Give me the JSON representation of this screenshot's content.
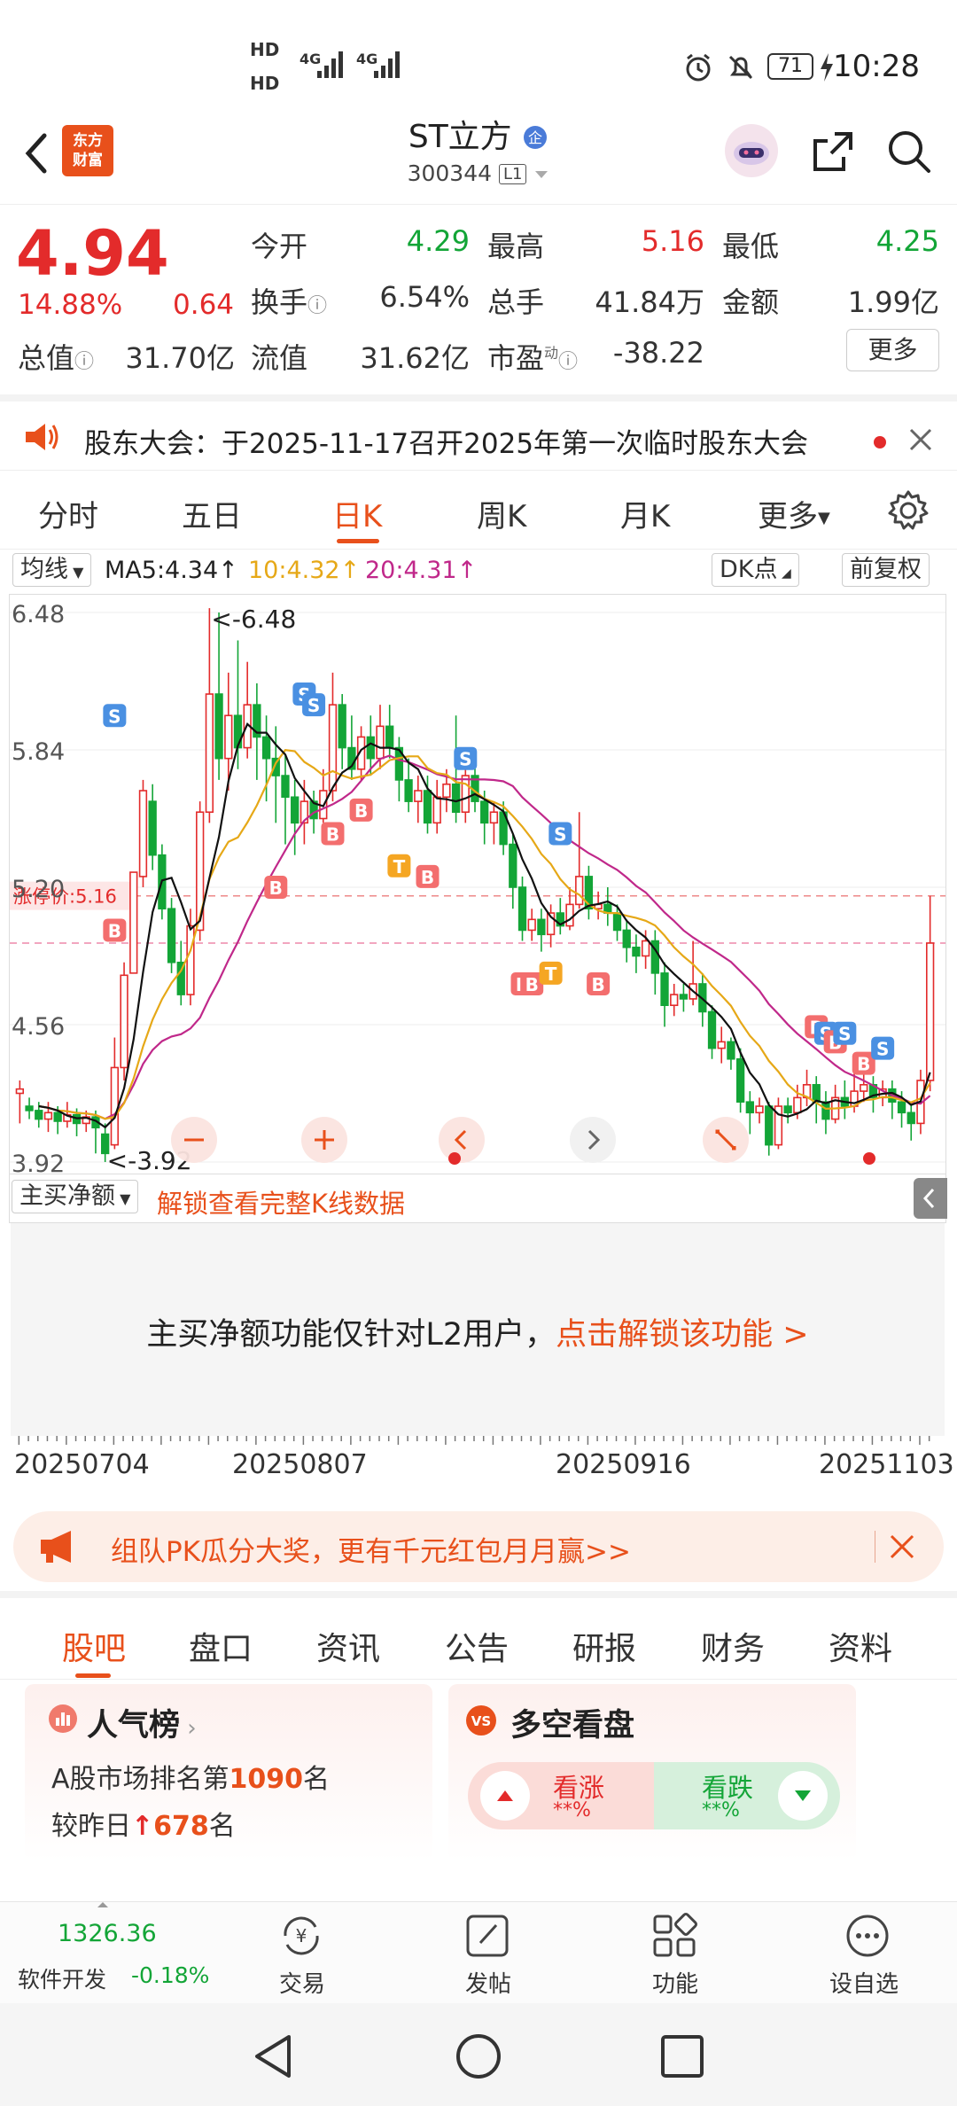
{
  "status_bar": {
    "hd1": "HD",
    "hd2": "HD",
    "net1": "4G",
    "net2": "4G",
    "battery": "71",
    "time": "10:28"
  },
  "header": {
    "logo_line1": "东方",
    "logo_line2": "财富",
    "title": "ST立方",
    "code": "300344",
    "level": "L1"
  },
  "quote": {
    "price": "4.94",
    "change_pct": "14.88%",
    "change": "0.64",
    "fields": [
      {
        "label": "今开",
        "value": "4.29"
      },
      {
        "label": "最高",
        "value": "5.16"
      },
      {
        "label": "最低",
        "value": "4.25"
      },
      {
        "label": "换手",
        "value": "6.54%"
      },
      {
        "label": "总手",
        "value": "41.84万"
      },
      {
        "label": "金额",
        "value": "1.99亿"
      },
      {
        "label": "总值",
        "value": "31.70亿"
      },
      {
        "label": "流值",
        "value": "31.62亿"
      },
      {
        "label": "市盈",
        "value": "-38.22"
      }
    ],
    "pe_sup": "动",
    "more_label": "更多"
  },
  "notice": {
    "text": "股东大会：于2025-11-17召开2025年第一次临时股东大会"
  },
  "chart_tabs": [
    "分时",
    "五日",
    "日K",
    "周K",
    "月K",
    "更多"
  ],
  "ma_bar": {
    "select": "均线",
    "ma5": "MA5:4.34↑",
    "ma10": "10:4.32↑",
    "ma20": "20:4.31↑",
    "dk": "DK点",
    "adj": "前复权"
  },
  "colors": {
    "accent": "#e8501b",
    "up": "#e32b2b",
    "down": "#13a537",
    "ma5": "#111111",
    "ma10": "#e6a817",
    "ma20": "#c0288a",
    "buy": "#f36e6e",
    "sell": "#4a90e2",
    "t": "#f5a623"
  },
  "chart_data": {
    "type": "candlestick",
    "y_ticks": [
      "6.48",
      "5.84",
      "5.20",
      "4.56",
      "3.92"
    ],
    "ylim": [
      3.92,
      6.48
    ],
    "max_label": "<-6.48",
    "min_label": "<-3.92",
    "limit_label": "涨停价:5.16",
    "limit_price": 5.16,
    "last_close": 4.94,
    "candles": [
      {
        "o": 4.24,
        "c": 4.26,
        "h": 4.3,
        "l": 4.1
      },
      {
        "o": 4.18,
        "c": 4.16,
        "h": 4.22,
        "l": 4.12
      },
      {
        "o": 4.16,
        "c": 4.12,
        "h": 4.2,
        "l": 4.08
      },
      {
        "o": 4.12,
        "c": 4.15,
        "h": 4.2,
        "l": 4.06
      },
      {
        "o": 4.15,
        "c": 4.11,
        "h": 4.18,
        "l": 4.05
      },
      {
        "o": 4.11,
        "c": 4.14,
        "h": 4.2,
        "l": 4.08
      },
      {
        "o": 4.14,
        "c": 4.1,
        "h": 4.17,
        "l": 4.04
      },
      {
        "o": 4.1,
        "c": 4.13,
        "h": 4.16,
        "l": 4.06
      },
      {
        "o": 4.13,
        "c": 4.08,
        "h": 4.16,
        "l": 3.96
      },
      {
        "o": 4.05,
        "c": 3.96,
        "h": 4.1,
        "l": 3.92
      },
      {
        "o": 4.0,
        "c": 4.36,
        "h": 4.5,
        "l": 3.98
      },
      {
        "o": 4.36,
        "c": 4.79,
        "h": 4.85,
        "l": 4.3
      },
      {
        "o": 4.8,
        "c": 5.27,
        "h": 5.27,
        "l": 4.8
      },
      {
        "o": 5.25,
        "c": 5.65,
        "h": 5.7,
        "l": 5.2
      },
      {
        "o": 5.6,
        "c": 5.35,
        "h": 5.68,
        "l": 5.28
      },
      {
        "o": 5.35,
        "c": 5.1,
        "h": 5.4,
        "l": 5.05
      },
      {
        "o": 5.1,
        "c": 4.85,
        "h": 5.15,
        "l": 4.8
      },
      {
        "o": 4.85,
        "c": 4.7,
        "h": 4.95,
        "l": 4.65
      },
      {
        "o": 4.7,
        "c": 5.02,
        "h": 5.1,
        "l": 4.65
      },
      {
        "o": 5.0,
        "c": 5.55,
        "h": 5.6,
        "l": 4.95
      },
      {
        "o": 5.55,
        "c": 6.1,
        "h": 6.5,
        "l": 5.5
      },
      {
        "o": 6.1,
        "c": 5.8,
        "h": 6.48,
        "l": 5.7
      },
      {
        "o": 5.8,
        "c": 6.0,
        "h": 6.2,
        "l": 5.65
      },
      {
        "o": 6.0,
        "c": 5.85,
        "h": 6.35,
        "l": 5.75
      },
      {
        "o": 5.85,
        "c": 6.05,
        "h": 6.25,
        "l": 5.8
      },
      {
        "o": 6.05,
        "c": 5.9,
        "h": 6.15,
        "l": 5.7
      },
      {
        "o": 5.9,
        "c": 5.8,
        "h": 6.0,
        "l": 5.6
      },
      {
        "o": 5.8,
        "c": 5.72,
        "h": 5.95,
        "l": 5.5
      },
      {
        "o": 5.72,
        "c": 5.62,
        "h": 5.82,
        "l": 5.4
      },
      {
        "o": 5.62,
        "c": 5.5,
        "h": 5.7,
        "l": 5.35
      },
      {
        "o": 5.5,
        "c": 5.6,
        "h": 5.7,
        "l": 5.4
      },
      {
        "o": 5.6,
        "c": 5.52,
        "h": 5.65,
        "l": 5.45
      },
      {
        "o": 5.52,
        "c": 5.65,
        "h": 5.75,
        "l": 5.5
      },
      {
        "o": 5.65,
        "c": 6.05,
        "h": 6.2,
        "l": 5.6
      },
      {
        "o": 6.05,
        "c": 5.85,
        "h": 6.1,
        "l": 5.75
      },
      {
        "o": 5.85,
        "c": 5.75,
        "h": 6.0,
        "l": 5.7
      },
      {
        "o": 5.75,
        "c": 5.9,
        "h": 5.95,
        "l": 5.7
      },
      {
        "o": 5.9,
        "c": 5.8,
        "h": 6.0,
        "l": 5.72
      },
      {
        "o": 5.8,
        "c": 5.95,
        "h": 6.05,
        "l": 5.75
      },
      {
        "o": 5.95,
        "c": 5.85,
        "h": 6.05,
        "l": 5.8
      },
      {
        "o": 5.85,
        "c": 5.7,
        "h": 5.9,
        "l": 5.6
      },
      {
        "o": 5.7,
        "c": 5.6,
        "h": 5.8,
        "l": 5.55
      },
      {
        "o": 5.6,
        "c": 5.65,
        "h": 5.72,
        "l": 5.5
      },
      {
        "o": 5.65,
        "c": 5.5,
        "h": 5.72,
        "l": 5.45
      },
      {
        "o": 5.5,
        "c": 5.62,
        "h": 5.7,
        "l": 5.45
      },
      {
        "o": 5.62,
        "c": 5.68,
        "h": 5.75,
        "l": 5.55
      },
      {
        "o": 5.68,
        "c": 5.55,
        "h": 6.0,
        "l": 5.5
      },
      {
        "o": 5.55,
        "c": 5.72,
        "h": 5.8,
        "l": 5.5
      },
      {
        "o": 5.72,
        "c": 5.6,
        "h": 5.78,
        "l": 5.55
      },
      {
        "o": 5.6,
        "c": 5.5,
        "h": 5.65,
        "l": 5.4
      },
      {
        "o": 5.5,
        "c": 5.55,
        "h": 5.6,
        "l": 5.4
      },
      {
        "o": 5.55,
        "c": 5.4,
        "h": 5.6,
        "l": 5.35
      },
      {
        "o": 5.4,
        "c": 5.2,
        "h": 5.45,
        "l": 5.1
      },
      {
        "o": 5.2,
        "c": 5.0,
        "h": 5.25,
        "l": 4.95
      },
      {
        "o": 5.0,
        "c": 5.05,
        "h": 5.1,
        "l": 4.95
      },
      {
        "o": 5.05,
        "c": 4.98,
        "h": 5.1,
        "l": 4.9
      },
      {
        "o": 4.98,
        "c": 5.08,
        "h": 5.12,
        "l": 4.92
      },
      {
        "o": 5.08,
        "c": 5.02,
        "h": 5.15,
        "l": 4.98
      },
      {
        "o": 5.02,
        "c": 5.12,
        "h": 5.2,
        "l": 5.0
      },
      {
        "o": 5.12,
        "c": 5.25,
        "h": 5.55,
        "l": 5.1
      },
      {
        "o": 5.25,
        "c": 5.1,
        "h": 5.3,
        "l": 5.05
      },
      {
        "o": 5.1,
        "c": 5.12,
        "h": 5.18,
        "l": 5.05
      },
      {
        "o": 5.12,
        "c": 5.08,
        "h": 5.2,
        "l": 5.02
      },
      {
        "o": 5.08,
        "c": 5.0,
        "h": 5.12,
        "l": 4.95
      },
      {
        "o": 5.0,
        "c": 4.92,
        "h": 5.05,
        "l": 4.85
      },
      {
        "o": 4.92,
        "c": 4.88,
        "h": 4.98,
        "l": 4.8
      },
      {
        "o": 4.88,
        "c": 4.95,
        "h": 5.0,
        "l": 4.82
      },
      {
        "o": 4.95,
        "c": 4.8,
        "h": 5.0,
        "l": 4.7
      },
      {
        "o": 4.8,
        "c": 4.65,
        "h": 4.85,
        "l": 4.55
      },
      {
        "o": 4.65,
        "c": 4.7,
        "h": 4.75,
        "l": 4.6
      },
      {
        "o": 4.7,
        "c": 4.68,
        "h": 4.75,
        "l": 4.62
      },
      {
        "o": 4.68,
        "c": 4.75,
        "h": 4.95,
        "l": 4.65
      },
      {
        "o": 4.75,
        "c": 4.62,
        "h": 4.8,
        "l": 4.55
      },
      {
        "o": 4.62,
        "c": 4.45,
        "h": 4.65,
        "l": 4.4
      },
      {
        "o": 4.45,
        "c": 4.48,
        "h": 4.55,
        "l": 4.38
      },
      {
        "o": 4.48,
        "c": 4.4,
        "h": 4.5,
        "l": 4.35
      },
      {
        "o": 4.4,
        "c": 4.2,
        "h": 4.45,
        "l": 4.15
      },
      {
        "o": 4.2,
        "c": 4.15,
        "h": 4.25,
        "l": 4.05
      },
      {
        "o": 4.15,
        "c": 4.18,
        "h": 4.22,
        "l": 4.1
      },
      {
        "o": 4.18,
        "c": 4.0,
        "h": 4.2,
        "l": 3.95
      },
      {
        "o": 4.0,
        "c": 4.18,
        "h": 4.22,
        "l": 3.98
      },
      {
        "o": 4.18,
        "c": 4.15,
        "h": 4.22,
        "l": 4.1
      },
      {
        "o": 4.15,
        "c": 4.22,
        "h": 4.28,
        "l": 4.12
      },
      {
        "o": 4.22,
        "c": 4.28,
        "h": 4.35,
        "l": 4.18
      },
      {
        "o": 4.28,
        "c": 4.2,
        "h": 4.32,
        "l": 4.1
      },
      {
        "o": 4.2,
        "c": 4.12,
        "h": 4.25,
        "l": 4.05
      },
      {
        "o": 4.12,
        "c": 4.22,
        "h": 4.28,
        "l": 4.1
      },
      {
        "o": 4.22,
        "c": 4.18,
        "h": 4.3,
        "l": 4.12
      },
      {
        "o": 4.18,
        "c": 4.25,
        "h": 4.35,
        "l": 4.15
      },
      {
        "o": 4.25,
        "c": 4.28,
        "h": 4.4,
        "l": 4.2
      },
      {
        "o": 4.28,
        "c": 4.22,
        "h": 4.32,
        "l": 4.15
      },
      {
        "o": 4.22,
        "c": 4.26,
        "h": 4.3,
        "l": 4.18
      },
      {
        "o": 4.26,
        "c": 4.2,
        "h": 4.3,
        "l": 4.12
      },
      {
        "o": 4.2,
        "c": 4.15,
        "h": 4.25,
        "l": 4.08
      },
      {
        "o": 4.15,
        "c": 4.1,
        "h": 4.2,
        "l": 4.02
      },
      {
        "o": 4.1,
        "c": 4.3,
        "h": 4.35,
        "l": 4.05
      },
      {
        "o": 4.3,
        "c": 4.94,
        "h": 5.16,
        "l": 4.25
      }
    ],
    "signals": [
      {
        "i": 10,
        "t": "S",
        "price": 6.0
      },
      {
        "i": 10,
        "t": "B",
        "price": 5.0
      },
      {
        "i": 27,
        "t": "B",
        "price": 5.2
      },
      {
        "i": 30,
        "t": "S",
        "price": 6.1
      },
      {
        "i": 31,
        "t": "S",
        "price": 6.05
      },
      {
        "i": 33,
        "t": "B",
        "price": 5.45
      },
      {
        "i": 36,
        "t": "B",
        "price": 5.56
      },
      {
        "i": 40,
        "t": "T",
        "price": 5.3
      },
      {
        "i": 43,
        "t": "B",
        "price": 5.25
      },
      {
        "i": 47,
        "t": "S",
        "price": 5.8
      },
      {
        "i": 53,
        "t": "B",
        "price": 4.75
      },
      {
        "i": 54,
        "t": "B",
        "price": 4.75
      },
      {
        "i": 56,
        "t": "T",
        "price": 4.8
      },
      {
        "i": 57,
        "t": "S",
        "price": 5.45
      },
      {
        "i": 61,
        "t": "B",
        "price": 4.75
      },
      {
        "i": 84,
        "t": "B",
        "price": 4.55
      },
      {
        "i": 85,
        "t": "S",
        "price": 4.52
      },
      {
        "i": 86,
        "t": "B",
        "price": 4.48
      },
      {
        "i": 87,
        "t": "S",
        "price": 4.52
      },
      {
        "i": 89,
        "t": "B",
        "price": 4.38
      },
      {
        "i": 91,
        "t": "S",
        "price": 4.45
      }
    ],
    "ma5_label": "MA5",
    "ma10_label": "MA10",
    "ma20_label": "MA20"
  },
  "indicator": {
    "select": "主买净额",
    "unlock": "解锁查看完整K线数据"
  },
  "lock_panel": {
    "msg": "主买净额功能仅针对L2用户，",
    "link": "点击解锁该功能 >"
  },
  "dates": [
    "20250704",
    "20250807",
    "20250916",
    "20251103"
  ],
  "promo": {
    "text": "组队PK瓜分大奖，更有千元红包月月赢>>"
  },
  "sub_tabs": [
    "股吧",
    "盘口",
    "资讯",
    "公告",
    "研报",
    "财务",
    "资料"
  ],
  "popularity_card": {
    "title": "人气榜",
    "line1_prefix": "A股市场排名第",
    "rank": "1090",
    "line1_suffix": "名",
    "line2_prefix": "较昨日",
    "change": "678",
    "line2_suffix": "名"
  },
  "bull_bear_card": {
    "title": "多空看盘",
    "bull": "看涨",
    "bull_pct": "**%",
    "bear": "看跌",
    "bear_pct": "**%"
  },
  "bottom_nav": {
    "index_value": "1326.36",
    "index_name": "软件开发",
    "index_change": "-0.18%",
    "items": [
      "交易",
      "发帖",
      "功能",
      "设自选"
    ]
  }
}
